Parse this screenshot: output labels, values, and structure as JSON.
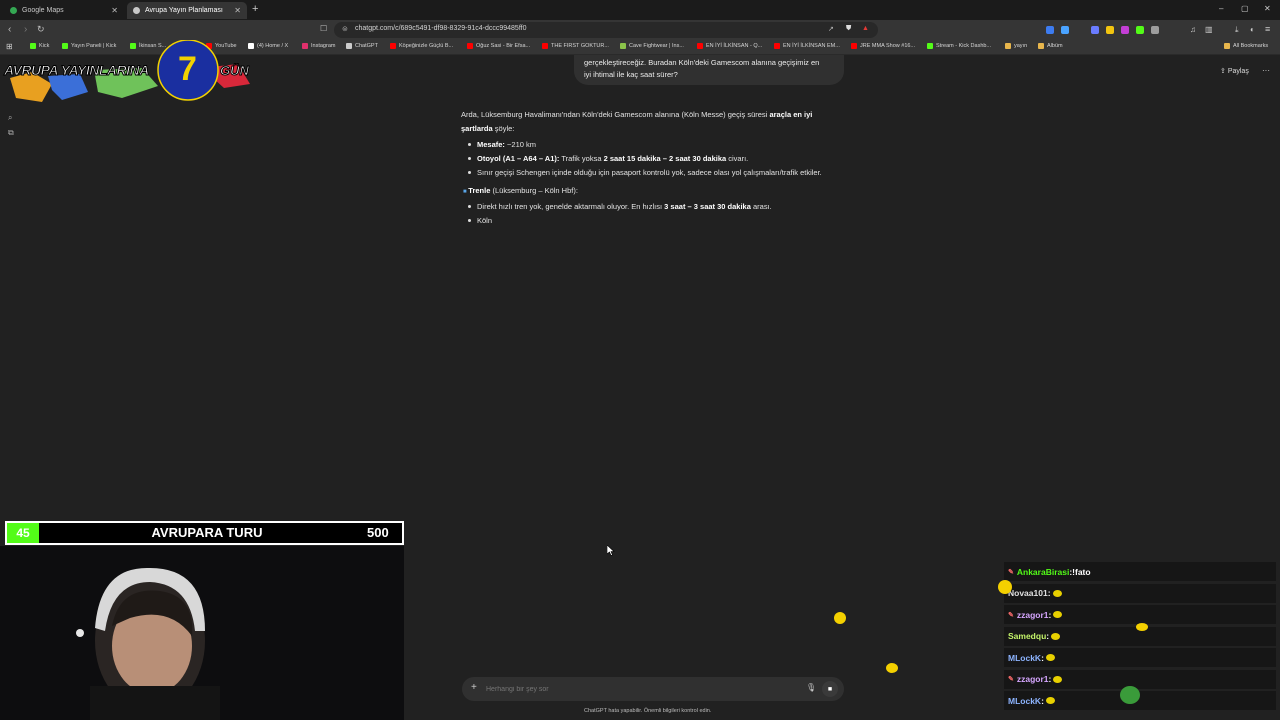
{
  "tabs": [
    {
      "title": "Google Maps",
      "icon_color": "#34a853",
      "active": false
    },
    {
      "title": "Avrupa Yayın Planlaması",
      "icon_color": "#c8c8c8",
      "active": true
    }
  ],
  "new_tab_symbol": "+",
  "window_controls": {
    "minimize": "–",
    "maximize": "▢",
    "close": "✕"
  },
  "address": {
    "url": "chatgpt.com/c/689c5491-df98-8329-91c4-dccc99485ff0"
  },
  "bookmarks": [
    {
      "label": "Kick",
      "color": "#53fc18"
    },
    {
      "label": "Yayın Paneli | Kick",
      "color": "#53fc18"
    },
    {
      "label": "İkinsan S...",
      "color": "#53fc18"
    },
    {
      "label": "YouTube",
      "color": "#ff0000"
    },
    {
      "label": "(4) Home / X",
      "color": "#ffffff"
    },
    {
      "label": "Instagram",
      "color": "#e1306c"
    },
    {
      "label": "ChatGPT",
      "color": "#cccccc"
    },
    {
      "label": "Köpeğinizle Güçlü B...",
      "color": "#ff0000"
    },
    {
      "label": "Oğuz Sasi - Bir Efsa...",
      "color": "#ff0000"
    },
    {
      "label": "THE FIRST GOKTUR...",
      "color": "#ff0000"
    },
    {
      "label": "Cave Fightwear | Ins...",
      "color": "#8bc34a"
    },
    {
      "label": "EN İYİ İLKİNSAN - Q...",
      "color": "#ff0000"
    },
    {
      "label": "EN İYİ İLKİNSAN EM...",
      "color": "#ff0000"
    },
    {
      "label": "JRE MMA Show #16...",
      "color": "#ff0000"
    },
    {
      "label": "Stream - Kick Dashb...",
      "color": "#53fc18"
    },
    {
      "label": "yayın",
      "color": "#e8b64c"
    },
    {
      "label": "Albüm",
      "color": "#e8b64c"
    }
  ],
  "all_bookmarks": "All Bookmarks",
  "logo": {
    "text_left": "AVRUPA YAYINLARINA",
    "number": "7",
    "text_right": "GÜN"
  },
  "header": {
    "share_label": "Paylaş",
    "more": "···"
  },
  "user_message": {
    "line1": "gerçekleştireceğiz. Buradan Köln'deki Gamescom alanına geçişimiz en",
    "line2": "iyi ihtimal ile kaç saat sürer?"
  },
  "answer": {
    "intro_a": "Arda, Lüksemburg Havalimanı'ndan Köln'deki Gamescom alanına (Köln Messe) geçiş süresi ",
    "intro_b": "araçla en iyi",
    "intro_c": "şartlarda",
    "intro_d": " şöyle:",
    "car_bullets": [
      {
        "bold": "Mesafe:",
        "text": " ~210 km"
      },
      {
        "bold": "Otoyol (A1 – A64 – A1):",
        "text": " Trafik yoksa ",
        "bold2": "2 saat 15 dakika – 2 saat 30 dakika",
        "text2": " civarı."
      },
      {
        "bold": "",
        "text": "Sınır geçişi Schengen içinde olduğu için pasaport kontrolü yok, sadece olası yol çalışmaları/trafik etkiler."
      }
    ],
    "train_heading_bold": "Trenle",
    "train_heading_rest": " (Lüksemburg – Köln Hbf):",
    "train_bullets": [
      {
        "text": "Direkt hızlı tren yok, genelde aktarmalı oluyor. En hızlısı ",
        "bold": "3 saat – 3 saat 30 dakika",
        "text2": " arası."
      },
      {
        "text": "Köln",
        "bold": "",
        "text2": ""
      }
    ]
  },
  "composer": {
    "placeholder": "Herhangi bir şey sor",
    "plus": "+",
    "stop": "■"
  },
  "disclaimer": "ChatGPT hata yapabilir. Önemli bilgileri kontrol edin.",
  "stream": {
    "counter_left": "45",
    "title": "AVRUPARA TURU",
    "counter_right": "500",
    "accent": "#53fc18"
  },
  "chat_messages": [
    {
      "user": "AnkaraBirasi",
      "text": "!fato",
      "color": "#53fc18",
      "badge": true
    },
    {
      "user": "Novaa101",
      "text": "",
      "color": "#e0e0e0",
      "badge": false
    },
    {
      "user": "zzagor1",
      "text": "",
      "color": "#d6a6ff",
      "badge": true
    },
    {
      "user": "Samedqu",
      "text": "",
      "color": "#c5f56a",
      "badge": false
    },
    {
      "user": "MLockK",
      "text": "",
      "color": "#8db4ff",
      "badge": false
    },
    {
      "user": "zzagor1",
      "text": "",
      "color": "#d6a6ff",
      "badge": true
    },
    {
      "user": "MLockK",
      "text": "",
      "color": "#8db4ff",
      "badge": false
    }
  ]
}
